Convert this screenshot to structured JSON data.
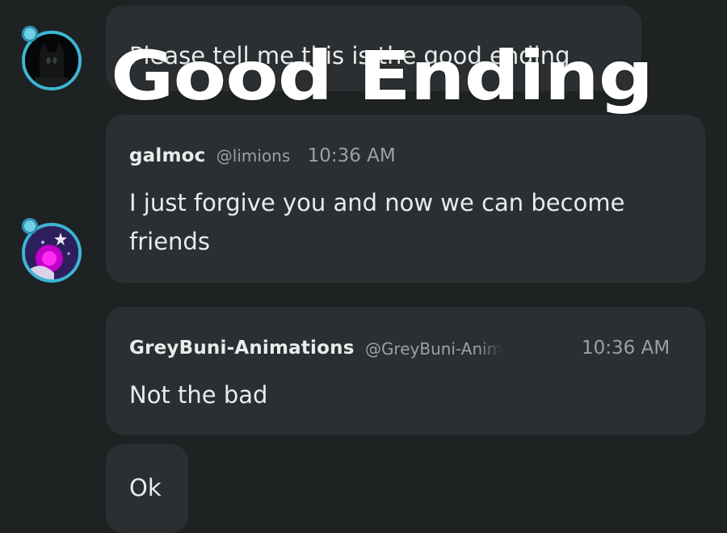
{
  "messages": [
    {
      "text": "Please tell me this is the good ending"
    },
    {
      "username": "galmoc",
      "handle": "@limions",
      "time": "10:36 AM",
      "text": "I just forgive you and now we can become friends"
    },
    {
      "username": "GreyBuni-Animations",
      "handle": "@GreyBuni-Anim",
      "time": "10:36 AM",
      "text": "Not the bad"
    },
    {
      "text": "Ok"
    }
  ],
  "overlay": {
    "caption": "Good Ending"
  },
  "colors": {
    "background": "#1e2223",
    "bubble": "#2b2f31",
    "avatar_ring": "#3db6d3",
    "text": "#e9ecec",
    "muted": "#9aa1a3"
  }
}
